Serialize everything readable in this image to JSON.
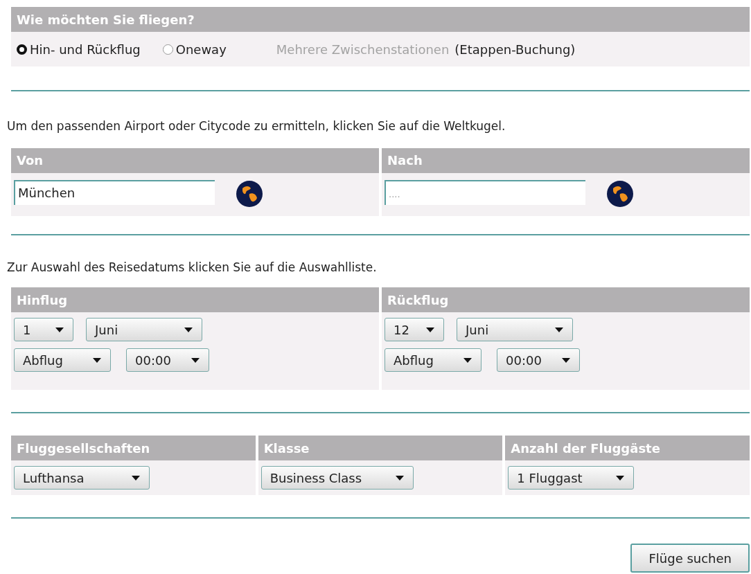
{
  "trip_type": {
    "title": "Wie möchten Sie fliegen?",
    "options": [
      {
        "label": "Hin- und Rückflug",
        "selected": true
      },
      {
        "label": "Oneway",
        "selected": false
      }
    ],
    "multi_stop_link": "Mehrere Zwischenstationen",
    "multi_stop_note": "(Etappen-Buchung)"
  },
  "airport_hint": "Um den passenden Airport oder Citycode zu ermitteln, klicken Sie auf die Weltkugel.",
  "locations": [
    {
      "title": "Von",
      "value": "München"
    },
    {
      "title": "Nach",
      "placeholder": "...."
    }
  ],
  "date_hint": "Zur Auswahl des Reisedatums klicken Sie auf die Auswahlliste.",
  "dates": [
    {
      "title": "Hinflug",
      "day": "1",
      "month": "Juni",
      "mode": "Abflug",
      "time": "00:00"
    },
    {
      "title": "Rückflug",
      "day": "12",
      "month": "Juni",
      "mode": "Abflug",
      "time": "00:00"
    }
  ],
  "preferences": [
    {
      "title": "Fluggesellschaften",
      "value": "Lufthansa"
    },
    {
      "title": "Klasse",
      "value": "Business Class"
    },
    {
      "title": "Anzahl der Fluggäste",
      "value": "1 Fluggast"
    }
  ],
  "search_button": "Flüge suchen"
}
